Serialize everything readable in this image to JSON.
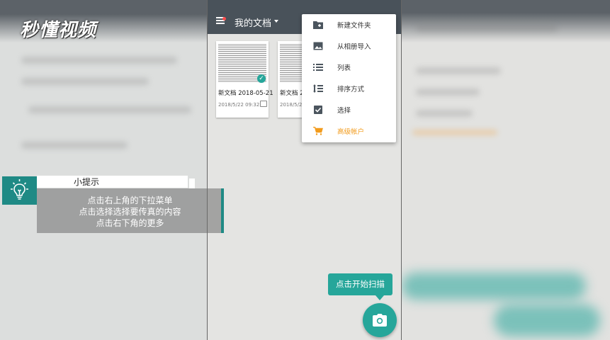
{
  "watermark": {
    "logo_text": "秒懂视频"
  },
  "app": {
    "title": "我的文档",
    "documents": [
      {
        "name": "新文档 2018-05-21",
        "date": "2018/5/22 09:32"
      },
      {
        "name": "新文档 2",
        "date": "2018/5/2"
      }
    ]
  },
  "menu": {
    "items": [
      {
        "label": "新建文件夹",
        "icon": "folder-add-icon"
      },
      {
        "label": "从相册导入",
        "icon": "image-icon"
      },
      {
        "label": "列表",
        "icon": "list-icon"
      },
      {
        "label": "排序方式",
        "icon": "sort-icon"
      },
      {
        "label": "选择",
        "icon": "checkbox-icon"
      },
      {
        "label": "高级帐户",
        "icon": "cart-icon"
      }
    ]
  },
  "tip": {
    "title": "小提示",
    "lines": [
      "点击右上角的下拉菜单",
      "点击选择选择要传真的内容",
      "点击右下角的更多"
    ]
  },
  "scan": {
    "prompt": "点击开始扫描"
  },
  "colors": {
    "accent": "#26a69a",
    "appbar": "#49525a",
    "premium": "#f29b1c",
    "tip_accent": "#1f8a85"
  }
}
